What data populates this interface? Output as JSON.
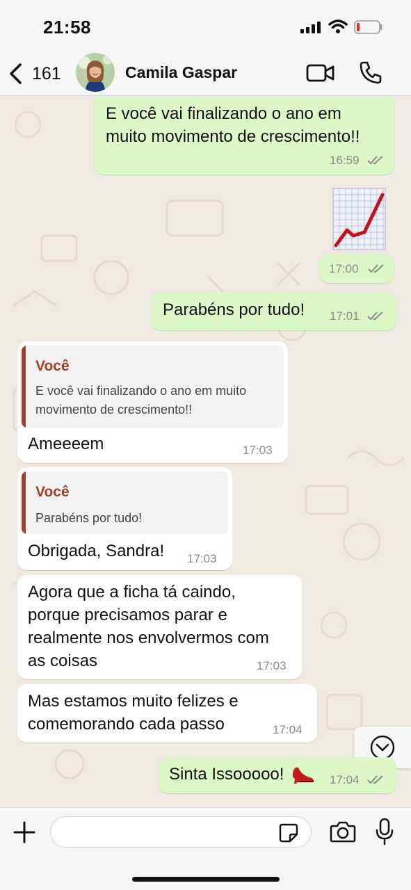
{
  "status": {
    "time": "21:58"
  },
  "header": {
    "unread_count": "161",
    "contact_name": "Camila Gaspar"
  },
  "messages": [
    {
      "type": "text",
      "direction": "outgoing",
      "lines": [
        "E você vai finalizando o ano em",
        "muito movimento de crescimento!!"
      ],
      "time": "16:59",
      "read": true
    },
    {
      "type": "sticker",
      "direction": "outgoing",
      "sticker": "chart-increasing-emoji",
      "time": "17:00",
      "read": true
    },
    {
      "type": "text",
      "direction": "outgoing",
      "lines": [
        "Parabéns por tudo!"
      ],
      "time": "17:01",
      "read": true
    },
    {
      "type": "reply",
      "direction": "incoming",
      "quote_author": "Você",
      "quote_lines": [
        "E você vai finalizando o ano em muito",
        "movimento de crescimento!!"
      ],
      "lines": [
        "Ameeeem"
      ],
      "time": "17:03"
    },
    {
      "type": "reply",
      "direction": "incoming",
      "quote_author": "Você",
      "quote_lines": [
        "Parabéns por tudo!"
      ],
      "lines": [
        "Obrigada, Sandra!"
      ],
      "time": "17:03"
    },
    {
      "type": "text",
      "direction": "incoming",
      "lines": [
        "Agora que a ficha tá caindo,",
        "porque precisamos parar e",
        "realmente nos envolvermos com",
        "as coisas"
      ],
      "time": "17:03"
    },
    {
      "type": "text",
      "direction": "incoming",
      "lines": [
        "Mas estamos muito felizes e",
        "comemorando cada passo"
      ],
      "time": "17:04"
    },
    {
      "type": "text",
      "direction": "outgoing",
      "lines": [
        "Sinta Issooooo!"
      ],
      "emoji": "high-heel-emoji",
      "time": "17:04",
      "read": true
    }
  ],
  "composer": {
    "value": "",
    "placeholder": ""
  },
  "colors": {
    "outgoing_bubble": "#dcf8c6",
    "incoming_bubble": "#ffffff",
    "wallpaper": "#efeae2",
    "quote_accent": "#a23f2b",
    "read_ticks": "#8a8a8a",
    "sticker_line": "#c1121f"
  },
  "icons": [
    "back-chevron-icon",
    "video-call-icon",
    "voice-call-icon",
    "check-double-icon",
    "scroll-down-icon",
    "plus-icon",
    "sticker-icon",
    "camera-icon",
    "microphone-icon",
    "signal-icon",
    "wifi-icon",
    "battery-icon"
  ]
}
